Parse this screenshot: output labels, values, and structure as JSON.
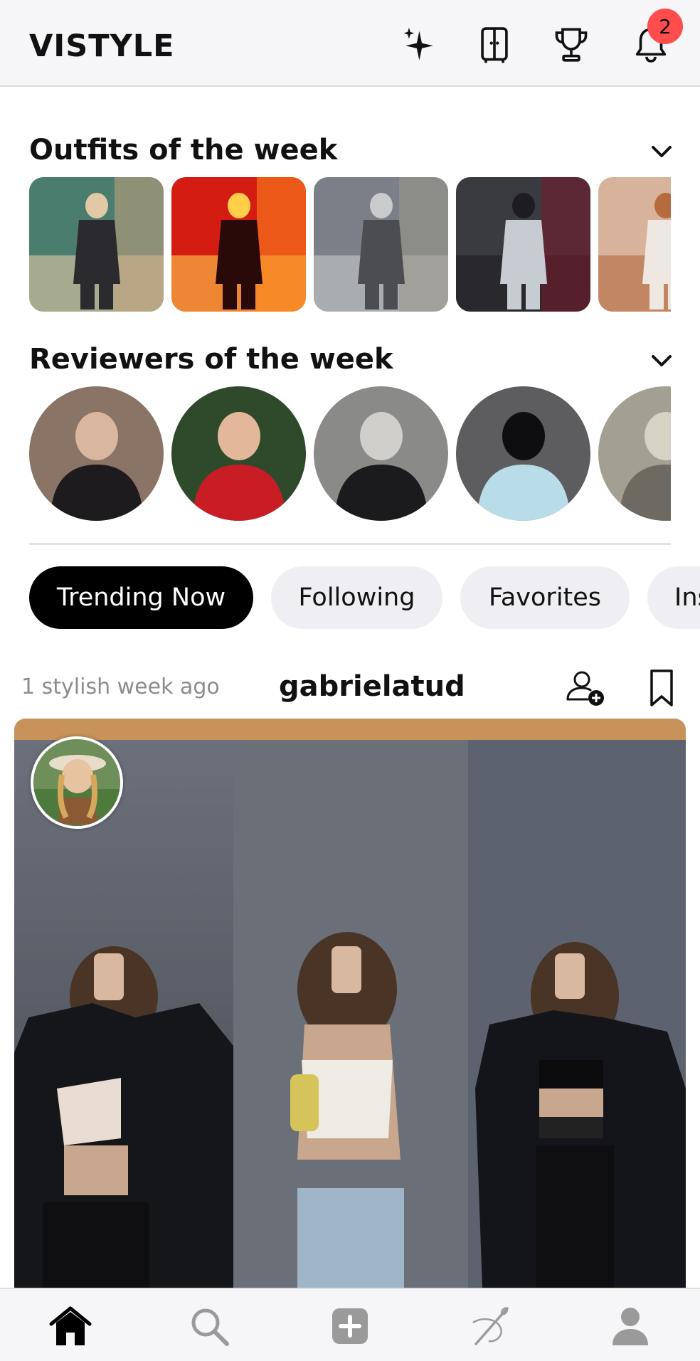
{
  "app": {
    "brand": "VISTYLE"
  },
  "header": {
    "icons": [
      "sparkles-icon",
      "wardrobe-icon",
      "trophy-icon",
      "bell-icon"
    ],
    "notification_count": "2",
    "badge_color": "#ff4d4d"
  },
  "outfits": {
    "title": "Outfits of the week",
    "items": [
      {
        "palette": [
          "#4b7d6e",
          "#c7a37b",
          "#2b2a2f",
          "#e2c9a6"
        ]
      },
      {
        "palette": [
          "#d41c12",
          "#ff8a1c",
          "#2a0a08",
          "#ffcf4a"
        ]
      },
      {
        "palette": [
          "#7b8088",
          "#9a9689",
          "#4b4d50",
          "#c9cbcc"
        ]
      },
      {
        "palette": [
          "#3a3b40",
          "#7a1a2c",
          "#c7cbd2",
          "#1c1c22"
        ]
      },
      {
        "palette": [
          "#d8b29a",
          "#8b8887",
          "#efe7e2",
          "#b46b3d"
        ]
      }
    ]
  },
  "reviewers": {
    "title": "Reviewers of the week",
    "items": [
      {
        "palette": [
          "#8a7466",
          "#1d1b1d",
          "#d8b69f"
        ]
      },
      {
        "palette": [
          "#2e4a2b",
          "#c91d25",
          "#e2b79a"
        ]
      },
      {
        "palette": [
          "#8a8a88",
          "#1b1b1d",
          "#d0cfcb"
        ]
      },
      {
        "palette": [
          "#5d5d5f",
          "#b8dde8",
          "#0e0e10"
        ]
      },
      {
        "palette": [
          "#a49f93",
          "#6d6a62",
          "#d8d2c5"
        ]
      }
    ]
  },
  "tabs": [
    {
      "label": "Trending Now",
      "active": true
    },
    {
      "label": "Following",
      "active": false
    },
    {
      "label": "Favorites",
      "active": false
    },
    {
      "label": "Ins",
      "active": false
    }
  ],
  "post": {
    "time": "1 stylish week ago",
    "username": "gabrielatud",
    "actions": [
      "add-user-icon",
      "bookmark-icon"
    ]
  },
  "bottom_nav": [
    "home-icon",
    "search-icon",
    "add-post-icon",
    "needle-icon",
    "profile-icon"
  ]
}
